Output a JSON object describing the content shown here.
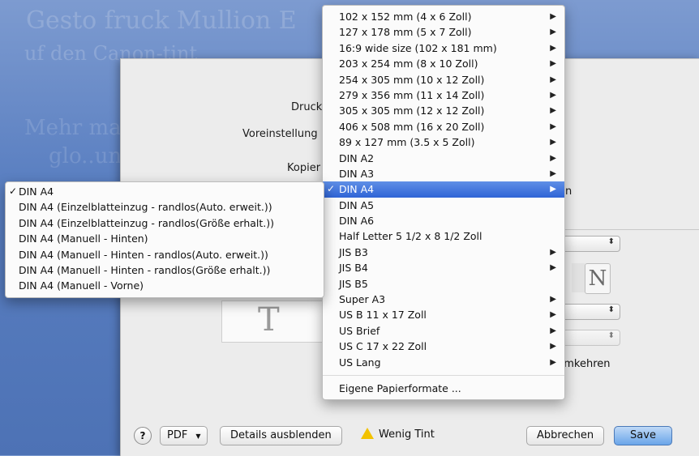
{
  "background": {
    "lines": [
      "Gesto fruck Mullion E",
      "uf den Canon-tint",
      "Mehr mallan sagt",
      "glo..unei aaue lie"
    ]
  },
  "dialog": {
    "label_drucker": "Druck",
    "label_voreinstellungen": "Voreinstellung",
    "label_kopien": "Kopier",
    "partial_right": "n",
    "reverse_text": "umkehren",
    "orientation_glyph": "N",
    "preview_glyph": "T"
  },
  "bottom_bar": {
    "help_label": "?",
    "pdf_label": "PDF",
    "details_label": "Details ausblenden",
    "warning_label": "Wenig Tint",
    "cancel_label": "Abbrechen",
    "save_label": "Save"
  },
  "main_menu": {
    "items": [
      {
        "label": "102 x 152 mm (4 x 6 Zoll)",
        "submenu": true,
        "checked": false
      },
      {
        "label": "127 x 178 mm (5 x 7 Zoll)",
        "submenu": true,
        "checked": false
      },
      {
        "label": "16:9 wide size (102 x 181 mm)",
        "submenu": true,
        "checked": false
      },
      {
        "label": "203 x 254 mm (8 x 10 Zoll)",
        "submenu": true,
        "checked": false
      },
      {
        "label": "254 x 305 mm (10 x 12 Zoll)",
        "submenu": true,
        "checked": false
      },
      {
        "label": "279 x 356 mm (11 x 14 Zoll)",
        "submenu": true,
        "checked": false
      },
      {
        "label": "305 x 305 mm (12 x 12 Zoll)",
        "submenu": true,
        "checked": false
      },
      {
        "label": "406 x 508 mm (16 x 20 Zoll)",
        "submenu": true,
        "checked": false
      },
      {
        "label": "89 x 127 mm (3.5 x 5 Zoll)",
        "submenu": true,
        "checked": false
      },
      {
        "label": "DIN A2",
        "submenu": true,
        "checked": false
      },
      {
        "label": "DIN A3",
        "submenu": true,
        "checked": false
      },
      {
        "label": "DIN A4",
        "submenu": true,
        "checked": true
      },
      {
        "label": "DIN A5",
        "submenu": false,
        "checked": false
      },
      {
        "label": "DIN A6",
        "submenu": false,
        "checked": false
      },
      {
        "label": "Half Letter 5 1/2 x 8 1/2 Zoll",
        "submenu": false,
        "checked": false
      },
      {
        "label": "JIS B3",
        "submenu": true,
        "checked": false
      },
      {
        "label": "JIS B4",
        "submenu": true,
        "checked": false
      },
      {
        "label": "JIS B5",
        "submenu": false,
        "checked": false
      },
      {
        "label": "Super A3",
        "submenu": true,
        "checked": false
      },
      {
        "label": "US B 11 x 17 Zoll",
        "submenu": true,
        "checked": false
      },
      {
        "label": "US Brief",
        "submenu": true,
        "checked": false
      },
      {
        "label": "US C 17 x 22 Zoll",
        "submenu": true,
        "checked": false
      },
      {
        "label": "US Lang",
        "submenu": true,
        "checked": false
      }
    ],
    "footer_item": "Eigene Papierformate ...",
    "selected_index": 11
  },
  "sub_menu": {
    "items": [
      {
        "label": "DIN A4",
        "checked": true
      },
      {
        "label": "DIN A4 (Einzelblatteinzug - randlos(Auto. erweit.))",
        "checked": false
      },
      {
        "label": "DIN A4 (Einzelblatteinzug - randlos(Größe erhalt.))",
        "checked": false
      },
      {
        "label": "DIN A4 (Manuell - Hinten)",
        "checked": false
      },
      {
        "label": "DIN A4 (Manuell - Hinten - randlos(Auto. erweit.))",
        "checked": false
      },
      {
        "label": "DIN A4 (Manuell - Hinten - randlos(Größe erhalt.))",
        "checked": false
      },
      {
        "label": "DIN A4 (Manuell - Vorne)",
        "checked": false
      }
    ]
  },
  "glyphs": {
    "check": "✓",
    "submenu_arrow": "▶",
    "popup_arrows": "⬍",
    "pdf_arrow": "▼"
  },
  "colors": {
    "selection": "#3369d8",
    "save_button": "#6aa5e9",
    "warning": "#f2c200"
  }
}
